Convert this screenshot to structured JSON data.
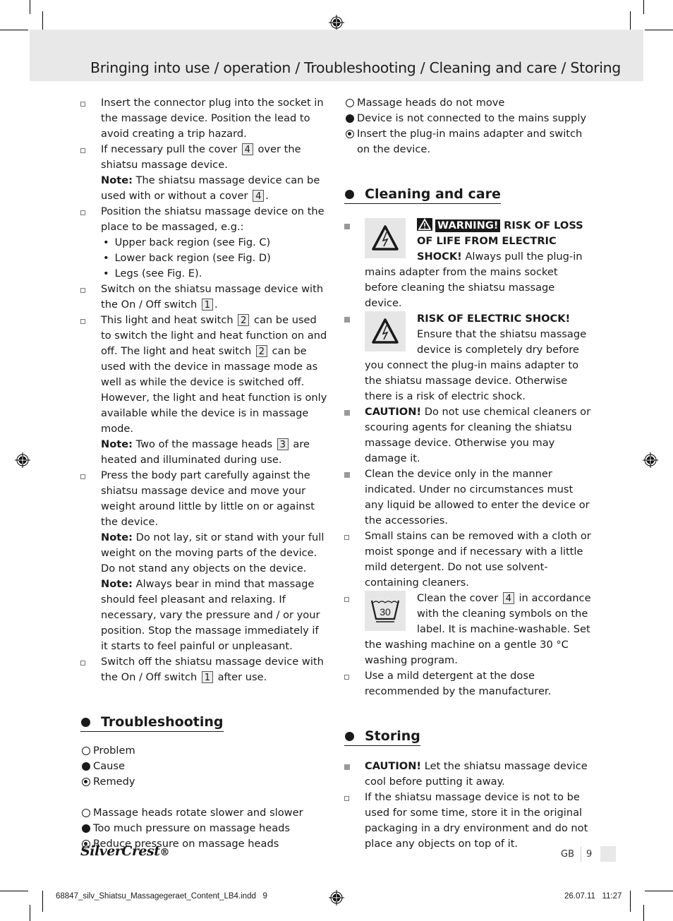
{
  "header": {
    "title": "Bringing into use / operation / Troubleshooting / Cleaning and care / Storing"
  },
  "left_column": {
    "items": [
      {
        "type": "open",
        "text": "Insert the connector plug into the socket in the massage device. Position the lead to avoid creating a trip hazard."
      },
      {
        "type": "open",
        "text_a": "If necessary pull the cover",
        "ref_a": "4",
        "text_b": "over the shiatsu massage device.",
        "note_label": "Note:",
        "note_text": "The shiatsu massage device can be used with or without a cover",
        "note_ref": "4",
        "note_end": "."
      },
      {
        "type": "open",
        "text": "Position the shiatsu massage device on the place to be massaged, e.g.:",
        "subs": [
          "Upper back region (see Fig. C)",
          "Lower back region (see Fig. D)",
          "Legs (see Fig. E)."
        ]
      },
      {
        "type": "open",
        "text_a": "Switch on the shiatsu massage device with the On / Off switch",
        "ref_a": "1",
        "text_b": "."
      },
      {
        "type": "open",
        "text_a": "This light and heat switch",
        "ref_a": "2",
        "text_b": "can be used to switch the light and heat function on and off. The light and heat switch",
        "ref_b": "2",
        "text_c": "can be used with the device in massage mode as well as while the device is switched off. However, the light and heat function is only available while the device is in massage mode.",
        "note_label": "Note:",
        "note_text": "Two of the massage heads",
        "note_ref": "3",
        "note_end": "are heated and illuminated during use."
      },
      {
        "type": "open",
        "text": "Press the body part carefully against the shiatsu massage device and move your weight around little by little on or against the device.",
        "note1_label": "Note:",
        "note1_text": "Do not lay, sit or stand with your full weight on the moving parts of the device. Do not stand any objects on the device.",
        "note2_label": "Note:",
        "note2_text": "Always bear in mind that massage should feel pleasant and relaxing. If necessary, vary the pressure and / or your position. Stop the massage immediately if it starts to feel painful or unpleasant."
      },
      {
        "type": "open",
        "text_a": "Switch off the shiatsu massage device with the On / Off switch",
        "ref_a": "1",
        "text_b": "after use."
      }
    ]
  },
  "troubleshooting": {
    "heading": "Troubleshooting",
    "legend": {
      "problem": "Problem",
      "cause": "Cause",
      "remedy": "Remedy"
    },
    "entries": [
      {
        "problem": "Massage heads rotate slower and slower",
        "cause": "Too much pressure on massage heads",
        "remedy": "Reduce pressure on massage heads"
      },
      {
        "problem": "Massage heads do not move",
        "cause": "Device is not connected to the mains supply",
        "remedy": "Insert the plug-in mains adapter and switch on the device."
      }
    ]
  },
  "cleaning": {
    "heading": "Cleaning and care",
    "warning_badge": "WARNING!",
    "warning_title": "RISK OF LOSS OF LIFE FROM ELECTRIC SHOCK!",
    "warning_text": "Always pull the plug-in mains adapter from the mains socket before cleaning the shiatsu massage device.",
    "shock_title": "RISK OF ELECTRIC SHOCK!",
    "shock_text": "Ensure that the shiatsu massage device is completely dry before you connect the plug-in mains adapter to the shiatsu massage device. Otherwise there is a risk of electric shock.",
    "caution_label": "CAUTION!",
    "caution_text": "Do not use chemical cleaners or scouring agents for cleaning the shiatsu massage device. Otherwise you may damage it.",
    "manner_text": "Clean the device only in the manner indicated. Under no circumstances must any liquid be allowed to enter the device or the accessories.",
    "stains_text": "Small stains can be removed with a cloth or moist sponge and if necessary with a little mild detergent. Do not use solvent-containing cleaners.",
    "wash_symbol": "30",
    "cover_text_a": "Clean the cover",
    "cover_ref": "4",
    "cover_text_b": "in accordance with the cleaning symbols on the label. It is machine-washable. Set the washing machine on a gentle 30 °C washing program.",
    "detergent_text": "Use a mild detergent at the dose recommended by the manufacturer."
  },
  "storing": {
    "heading": "Storing",
    "caution_label": "CAUTION!",
    "caution_text": "Let the shiatsu massage device cool before putting it away.",
    "store_text": "If the shiatsu massage device is not to be used for some time, store it in the original packaging in a dry environment and do not place any objects on top of it."
  },
  "footer": {
    "brand": "SilverCrest",
    "brand_mark": "®",
    "language": "GB",
    "page_number": "9"
  },
  "slug": {
    "file": "68847_silv_Shiatsu_Massagegeraet_Content_LB4.indd   9",
    "datetime": "26.07.11   11:27"
  }
}
